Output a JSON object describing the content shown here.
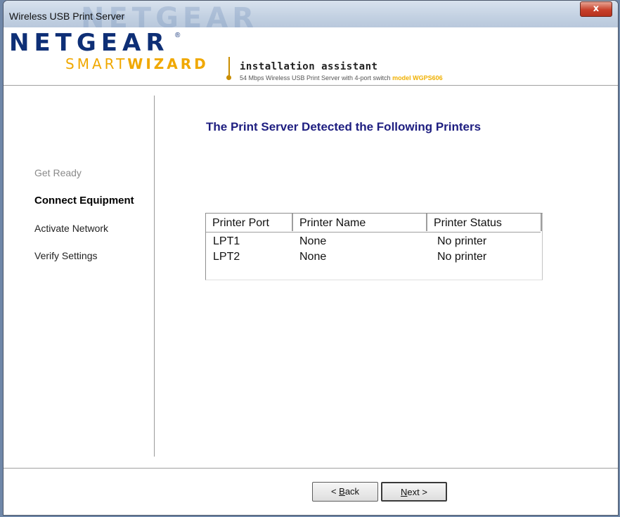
{
  "window": {
    "title": "Wireless USB Print Server",
    "watermark": "NETGEAR",
    "close_glyph": "x"
  },
  "header": {
    "brand": "NETGEAR",
    "brand_reg": "®",
    "product_light": "SMART",
    "product_bold": "WIZARD",
    "tagline": "installation assistant",
    "subline": "54 Mbps Wireless USB Print Server with 4-port switch",
    "model": "model WGPS606",
    "accent_color": "#f0a800",
    "brand_color": "#0e2f76"
  },
  "sidebar": {
    "items": [
      {
        "label": "Get Ready",
        "state": "done"
      },
      {
        "label": "Connect Equipment",
        "state": "active"
      },
      {
        "label": "Activate Network",
        "state": "pending"
      },
      {
        "label": "Verify Settings",
        "state": "pending"
      }
    ]
  },
  "main": {
    "title": "The Print Server Detected the Following Printers",
    "table": {
      "headers": [
        "Printer Port",
        "Printer Name",
        "Printer Status"
      ],
      "rows": [
        [
          "LPT1",
          "None",
          "No printer"
        ],
        [
          "LPT2",
          "None",
          "No printer"
        ]
      ]
    }
  },
  "buttons": {
    "back_prefix": "< ",
    "back_mnemonic": "B",
    "back_rest": "ack",
    "next_mnemonic": "N",
    "next_rest": "ext >"
  }
}
